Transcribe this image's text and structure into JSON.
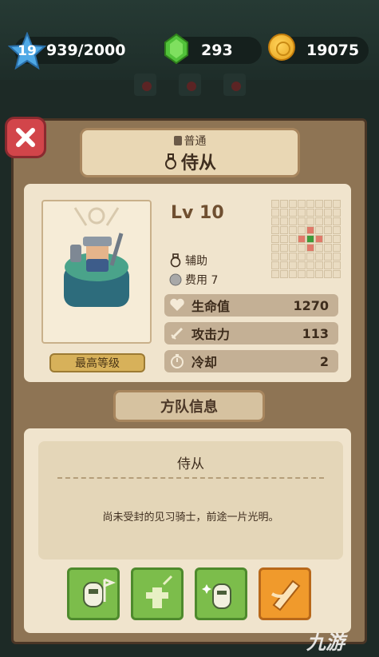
{
  "resources": {
    "level": "19",
    "xp": "939/2000",
    "gems": "293",
    "coins": "19075"
  },
  "unit": {
    "rarity": "普通",
    "name": "侍从",
    "level_text": "Lv 10",
    "role": "辅助",
    "cost": "费用 7",
    "max_level_label": "最高等级",
    "stats": [
      {
        "label": "生命值",
        "value": "1270",
        "icon": "heart-icon"
      },
      {
        "label": "攻击力",
        "value": "113",
        "icon": "sword-icon"
      },
      {
        "label": "冷却",
        "value": "2",
        "icon": "timer-icon"
      }
    ]
  },
  "formation": {
    "section_title": "方队信息",
    "name": "侍从",
    "description": "尚未受封的见习骑士，前途一片光明。",
    "skills": [
      {
        "icon": "knight-banner-icon",
        "color": "#7cbd4b"
      },
      {
        "icon": "sword-totem-icon",
        "color": "#7cbd4b"
      },
      {
        "icon": "sparkle-knight-icon",
        "color": "#7cbd4b"
      },
      {
        "icon": "scroll-icon",
        "color": "#f09a2c"
      }
    ]
  },
  "watermark": "九游"
}
